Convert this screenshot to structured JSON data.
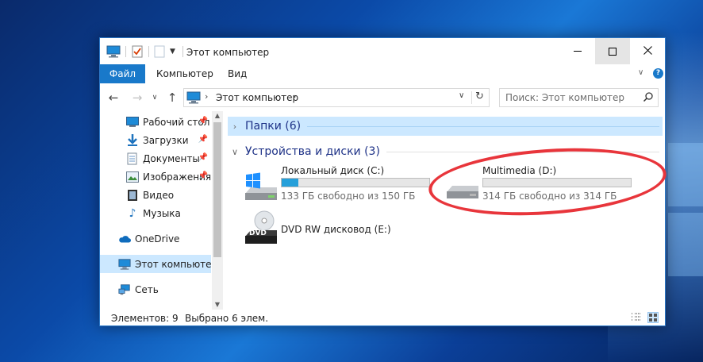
{
  "window": {
    "title": "Этот компьютер",
    "controls": [
      "minimize",
      "maximize",
      "close"
    ]
  },
  "ribbon": {
    "tabs": [
      {
        "label": "Файл",
        "active": true
      },
      {
        "label": "Компьютер"
      },
      {
        "label": "Вид"
      }
    ]
  },
  "address": {
    "path": "Этот компьютер",
    "search_placeholder": "Поиск: Этот компьютер"
  },
  "sidebar": {
    "items": [
      {
        "label": "Рабочий стол",
        "icon": "desktop-icon",
        "pinned": true
      },
      {
        "label": "Загрузки",
        "icon": "download-icon",
        "pinned": true
      },
      {
        "label": "Документы",
        "icon": "documents-icon",
        "pinned": true
      },
      {
        "label": "Изображения",
        "icon": "pictures-icon",
        "pinned": true
      },
      {
        "label": "Видео",
        "icon": "video-icon"
      },
      {
        "label": "Музыка",
        "icon": "music-icon"
      },
      {
        "label": "OneDrive",
        "icon": "cloud-icon"
      },
      {
        "label": "Этот компьютер",
        "icon": "computer-icon",
        "selected": true
      },
      {
        "label": "Сеть",
        "icon": "network-icon"
      }
    ]
  },
  "content": {
    "groups": [
      {
        "label": "Папки (6)",
        "expanded": false,
        "selected": true
      },
      {
        "label": "Устройства и диски (3)",
        "expanded": true
      }
    ],
    "drives": [
      {
        "name": "Локальный диск (C:)",
        "free_text": "133 ГБ свободно из 150 ГБ",
        "used_fraction": 0.113,
        "icon": "windows-drive-icon"
      },
      {
        "name": "Multimedia (D:)",
        "free_text": "314 ГБ свободно из 314 ГБ",
        "used_fraction": 0.0,
        "icon": "hard-drive-icon"
      },
      {
        "name": "DVD RW дисковод (E:)",
        "icon": "dvd-drive-icon"
      }
    ]
  },
  "status": {
    "items_count": "Элементов: 9",
    "selected": "Выбрано 6 элем."
  },
  "colors": {
    "accent": "#1979ca",
    "selection": "#cce8ff",
    "highlight_ring": "#e8353b",
    "bar_fill": "#26a0da"
  }
}
